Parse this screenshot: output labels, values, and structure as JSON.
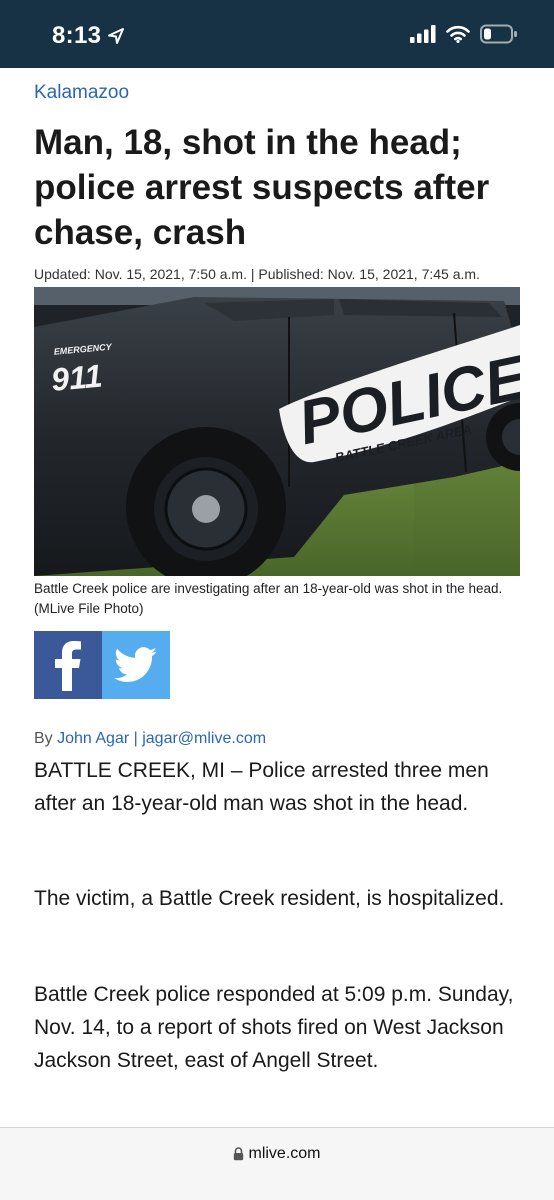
{
  "status_bar": {
    "time": "8:13",
    "icons": [
      "location-arrow-icon",
      "cellular-signal-icon",
      "wifi-icon",
      "battery-icon"
    ]
  },
  "article": {
    "section": "Kalamazoo",
    "headline": "Man, 18, shot in the head; police arrest suspects after chase, crash",
    "meta": "Updated: Nov. 15, 2021, 7:50 a.m. | Published: Nov. 15, 2021, 7:45 a.m.",
    "photo": {
      "car_text_emergency": "EMERGENCY",
      "car_text_911": "911",
      "car_text_police": "POLICE",
      "car_text_area": "BATTLE CREEK AREA"
    },
    "caption": "Battle Creek police are investigating after an 18-year-old was shot in the head. (MLive File Photo)",
    "share": [
      "facebook-icon",
      "twitter-icon"
    ],
    "byline_prefix": "By",
    "byline_author": "John Agar | jagar@mlive.com",
    "paragraphs": [
      "BATTLE CREEK, MI – Police arrested three men after an 18-year-old man was shot in the head.",
      "The victim, a Battle Creek resident, is hospitalized.",
      "Battle Creek police responded at 5:09 p.m. Sunday, Nov. 14, to a report of shots fired on West Jackson Jackson Street, east of Angell Street."
    ]
  },
  "browser": {
    "url": "mlive.com"
  },
  "colors": {
    "status_bar_bg": "#173245",
    "link": "#2b66b5",
    "facebook": "#3b5998",
    "twitter": "#55acee"
  }
}
